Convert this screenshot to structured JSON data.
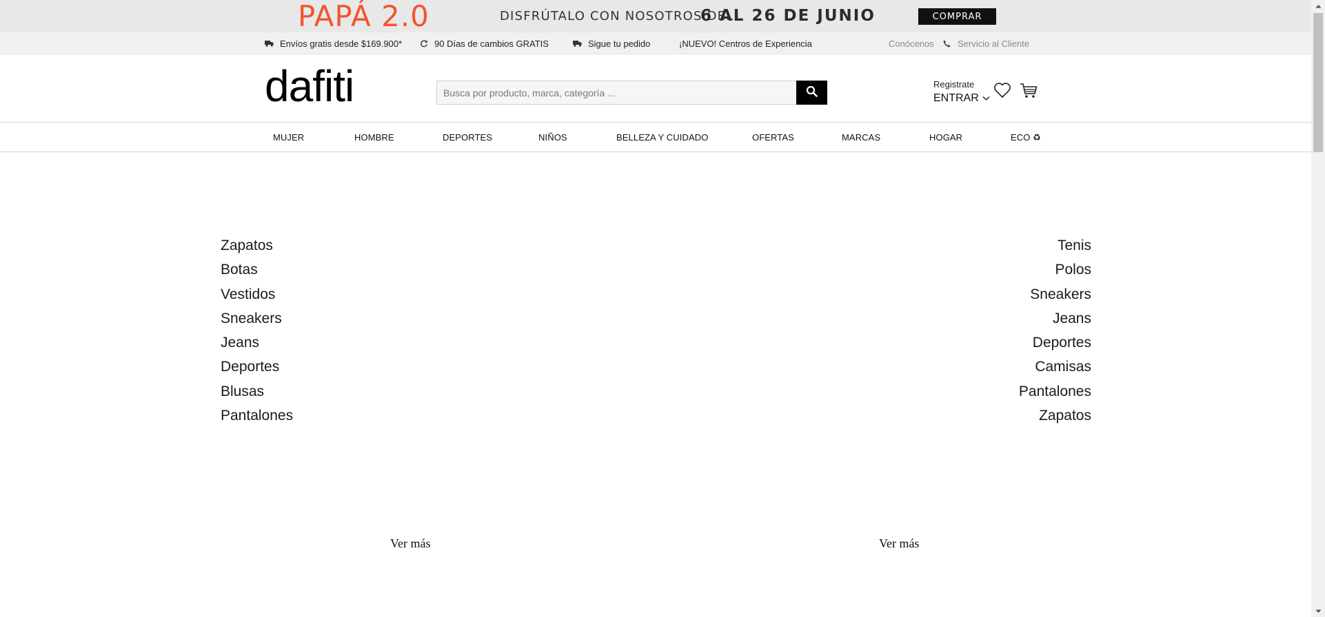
{
  "promo": {
    "title": "PAPÁ 2.0",
    "subtitle": "DISFRÚTALO CON NOSOTROS DEL",
    "dates": "6 AL 26 DE JUNIO",
    "button_label": "COMPRAR",
    "title_color": "#f2552c"
  },
  "info_bar": {
    "shipping": "Envíos gratis desde $169.900*",
    "returns": "90 Días de cambios GRATIS",
    "track": "Sigue tu pedido",
    "experience": "¡NUEVO! Centros de Experiencia",
    "about": "Conócenos",
    "support": "Servicio al Cliente"
  },
  "header": {
    "logo": "dafiti",
    "search_placeholder": "Busca por producto, marca, categoría ...",
    "register": "Registrate",
    "login": "ENTRAR"
  },
  "nav": {
    "items": [
      {
        "label": "MUJER"
      },
      {
        "label": "HOMBRE"
      },
      {
        "label": "DEPORTES"
      },
      {
        "label": "NIÑOS"
      },
      {
        "label": "BELLEZA Y CUIDADO"
      },
      {
        "label": "OFERTAS"
      },
      {
        "label": "MARCAS"
      },
      {
        "label": "HOGAR"
      },
      {
        "label": "ECO ♻"
      }
    ]
  },
  "women_categories": [
    "Zapatos",
    "Botas",
    "Vestidos",
    "Sneakers",
    "Jeans",
    "Deportes",
    "Blusas",
    "Pantalones"
  ],
  "men_categories": [
    "Tenis",
    "Polos",
    "Sneakers",
    "Jeans",
    "Deportes",
    "Camisas",
    "Pantalones",
    "Zapatos"
  ],
  "see_more_left": "Ver más",
  "see_more_right": "Ver más"
}
